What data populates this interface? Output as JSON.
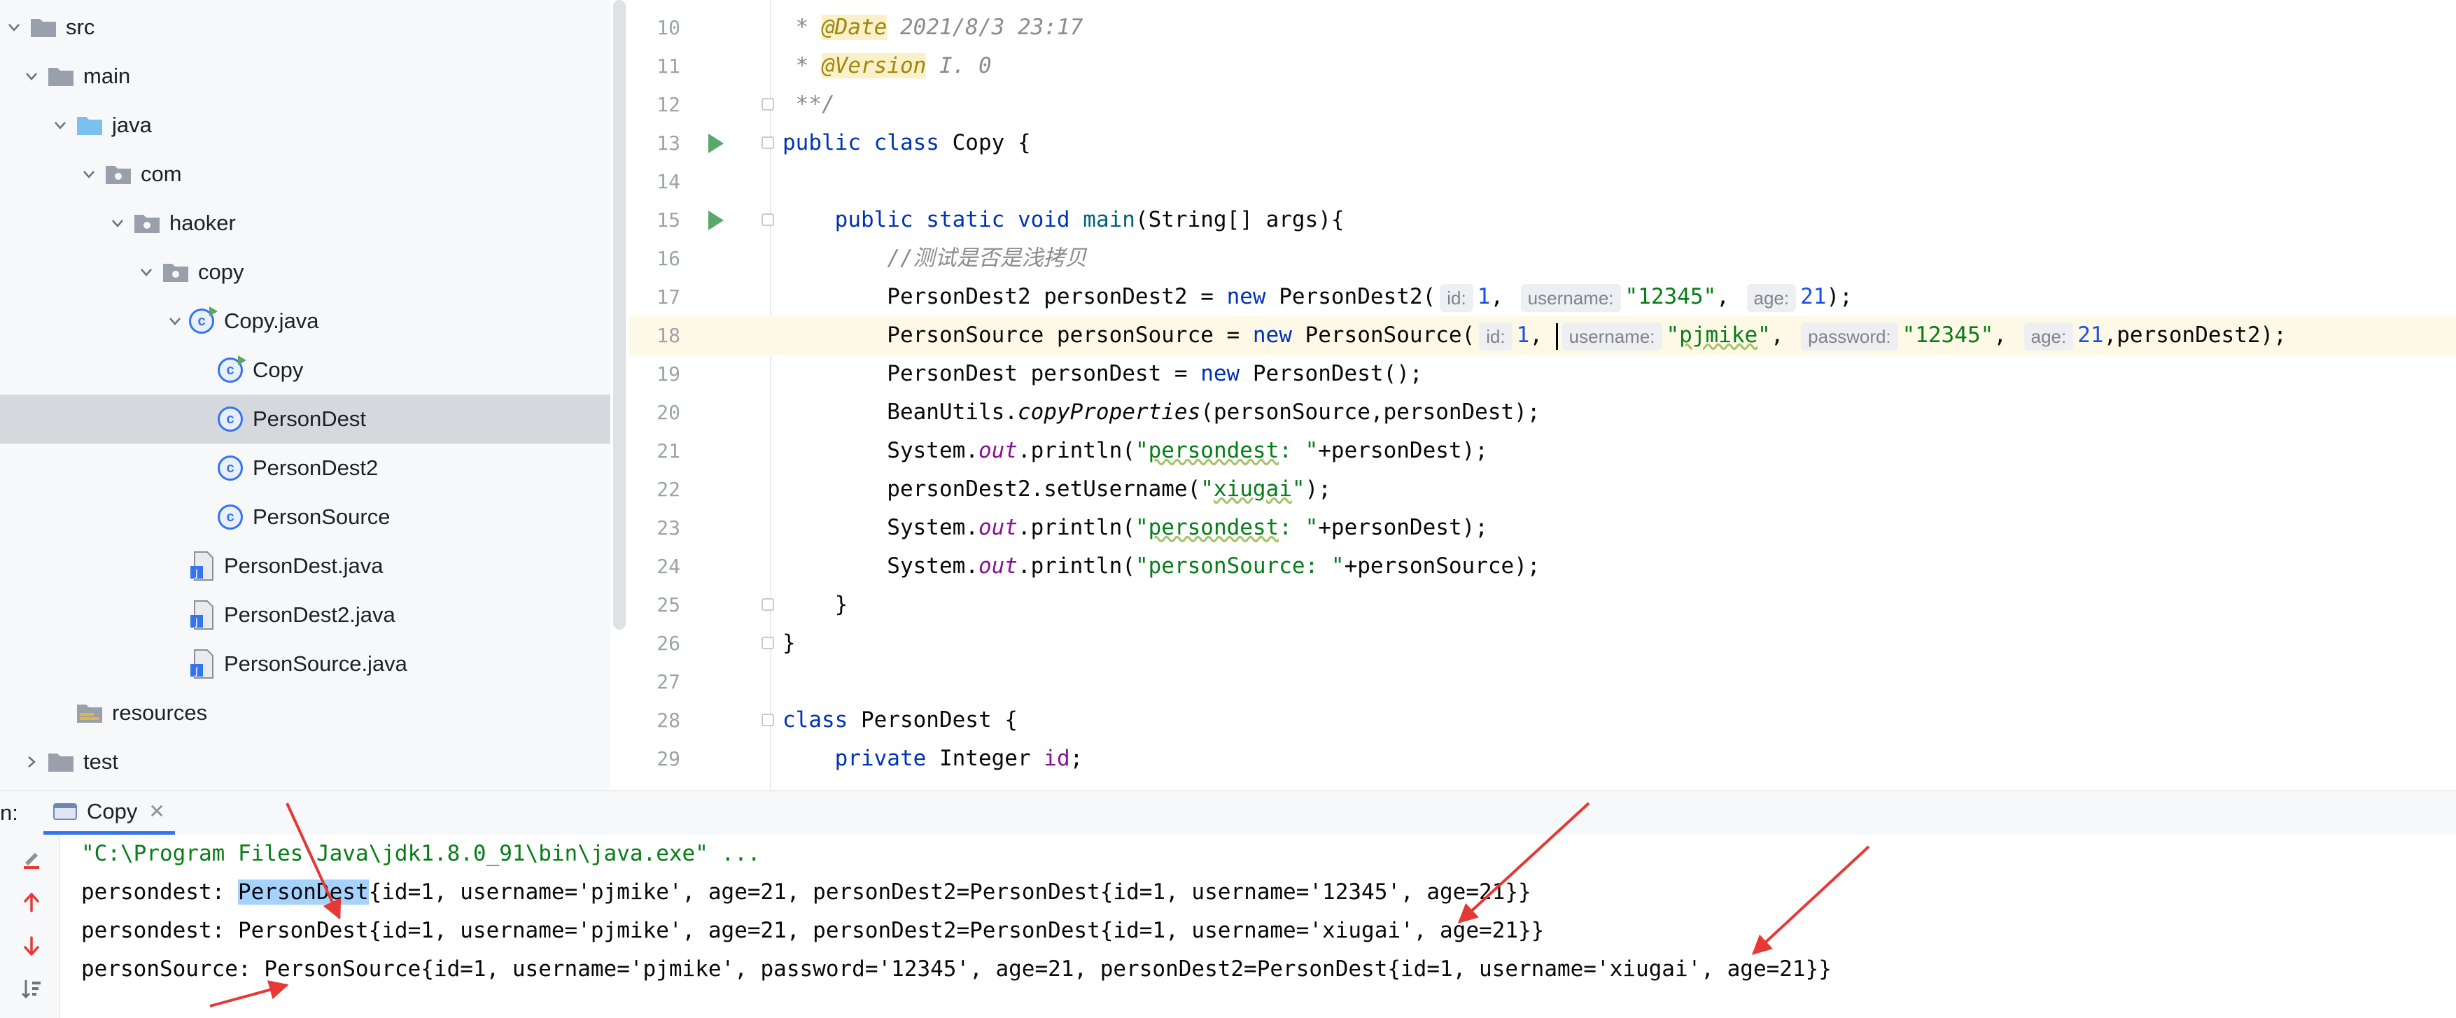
{
  "tree": {
    "items": [
      {
        "label": "src",
        "depth": 0,
        "chevron": "down",
        "icon": "folder"
      },
      {
        "label": "main",
        "depth": 1,
        "chevron": "down",
        "icon": "folder"
      },
      {
        "label": "java",
        "depth": 2,
        "chevron": "down",
        "icon": "source-folder"
      },
      {
        "label": "com",
        "depth": 3,
        "chevron": "down",
        "icon": "package"
      },
      {
        "label": "haoker",
        "depth": 4,
        "chevron": "down",
        "icon": "package"
      },
      {
        "label": "copy",
        "depth": 5,
        "chevron": "down",
        "icon": "package"
      },
      {
        "label": "Copy.java",
        "depth": 6,
        "chevron": "down",
        "icon": "class-run"
      },
      {
        "label": "Copy",
        "depth": 7,
        "chevron": "none",
        "icon": "class-run"
      },
      {
        "label": "PersonDest",
        "depth": 7,
        "chevron": "none",
        "icon": "class",
        "selected": true
      },
      {
        "label": "PersonDest2",
        "depth": 7,
        "chevron": "none",
        "icon": "class"
      },
      {
        "label": "PersonSource",
        "depth": 7,
        "chevron": "none",
        "icon": "class"
      },
      {
        "label": "PersonDest.java",
        "depth": 6,
        "chevron": "none",
        "icon": "java-file"
      },
      {
        "label": "PersonDest2.java",
        "depth": 6,
        "chevron": "none",
        "icon": "java-file"
      },
      {
        "label": "PersonSource.java",
        "depth": 6,
        "chevron": "none",
        "icon": "java-file"
      },
      {
        "label": "resources",
        "depth": 2,
        "chevron": "none",
        "icon": "resources-folder"
      },
      {
        "label": "test",
        "depth": 1,
        "chevron": "right",
        "icon": "folder"
      }
    ]
  },
  "editor": {
    "line_numbers": [
      "10",
      "11",
      "12",
      "13",
      "14",
      "15",
      "16",
      "17",
      "18",
      "19",
      "20",
      "21",
      "22",
      "23",
      "24",
      "25",
      "26",
      "27",
      "28",
      "29"
    ],
    "current_line": "18"
  },
  "run": {
    "label": "n:",
    "tab_label": "Copy",
    "console": [
      "\"C:\\Program Files\\Java\\jdk1.8.0_91\\bin\\java.exe\" ...",
      "{id=1, username='pjmike', age=21, personDest2=PersonDest{id=1, username='12345', age=21}}",
      "persondest: PersonDest{id=1, username='pjmike', age=21, personDest2=PersonDest{id=1, username='xiugai', age=21}}",
      "personSource: PersonSource{id=1, username='pjmike', password='12345', age=21, personDest2=PersonDest{id=1, username='xiugai', age=21}}"
    ],
    "console_prefix": "persondest: ",
    "console_highlight": "PersonDest"
  },
  "colors": {
    "accent": "#3574f0",
    "arrow": "#e53935",
    "run_green": "#59a869",
    "keyword": "#0033b3",
    "string": "#067d17"
  }
}
